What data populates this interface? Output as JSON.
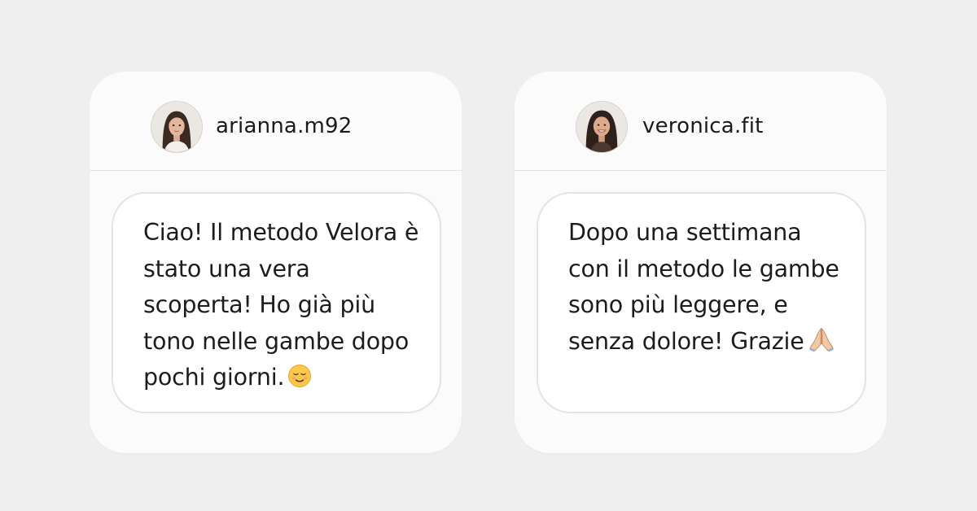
{
  "testimonials": [
    {
      "username": "arianna.m92",
      "avatar_icon": "avatar-woman-dark-hair",
      "message": "Ciao! Il metodo Velora è stato una vera scoperta! Ho già più tono nelle gambe dopo pochi giorni.",
      "emoji": "relieved-face-emoji"
    },
    {
      "username": "veronica.fit",
      "avatar_icon": "avatar-woman-smiling",
      "message": "Dopo una settimana con il metodo le gambe sono più leggere, e senza dolore! Grazie",
      "emoji": "folded-hands-emoji"
    }
  ]
}
